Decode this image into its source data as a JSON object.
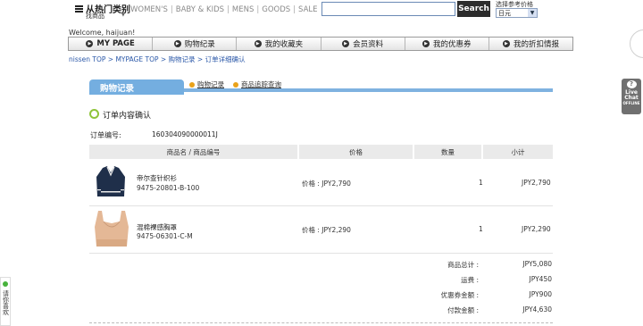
{
  "header": {
    "category_title": "从热门类别",
    "category_sub": "找商品",
    "nav_links": [
      "WOMEN'S",
      "BABY & KIDS",
      "MENS",
      "GOODS",
      "SALE"
    ],
    "search_button": "Search",
    "search_placeholder": "",
    "currency_label": "选择参考价格",
    "currency_value": "日元"
  },
  "welcome": "Welcome, haijuan!",
  "navbar": [
    "MY PAGE",
    "购物纪录",
    "我的收藏夹",
    "会员资料",
    "我的优惠券",
    "我的折扣情报"
  ],
  "breadcrumb": "nissen TOP > MYPAGE  TOP > 购物记录 > 订单详细确认",
  "section": {
    "tab": "购物记录",
    "subtabs": [
      "购物记录",
      "商品追踪查询"
    ],
    "title": "订单内容确认"
  },
  "order": {
    "label": "订单编号:",
    "number": "160304090000011J"
  },
  "table": {
    "headers": [
      "商品名 / 商品编号",
      "价格",
      "数量",
      "小计"
    ],
    "rows": [
      {
        "name": "帝尔查针织衫",
        "code": "9475-20801-B-100",
        "price": "价格 :  JPY2,790",
        "qty": "1",
        "subtotal": "JPY2,790"
      },
      {
        "name": "混棉裸感胸罩",
        "code": "9475-06301-C-M",
        "price": "价格 :  JPY2,290",
        "qty": "1",
        "subtotal": "JPY2,290"
      }
    ]
  },
  "summary": [
    {
      "label": "商品总计 :",
      "value": "JPY5,080"
    },
    {
      "label": "运费 :",
      "value": "JPY450"
    },
    {
      "label": "优惠券金额 :",
      "value": "JPY900"
    },
    {
      "label": "付款金额 :",
      "value": "JPY4,630"
    }
  ],
  "chat": {
    "line1": "Live",
    "line2": "Chat",
    "line3": "OFFLINE"
  },
  "left_widget": "请你喜欢",
  "colors": {
    "accent_blue": "#74aee0",
    "link_blue": "#2b58a8",
    "green": "#8fc43a"
  }
}
